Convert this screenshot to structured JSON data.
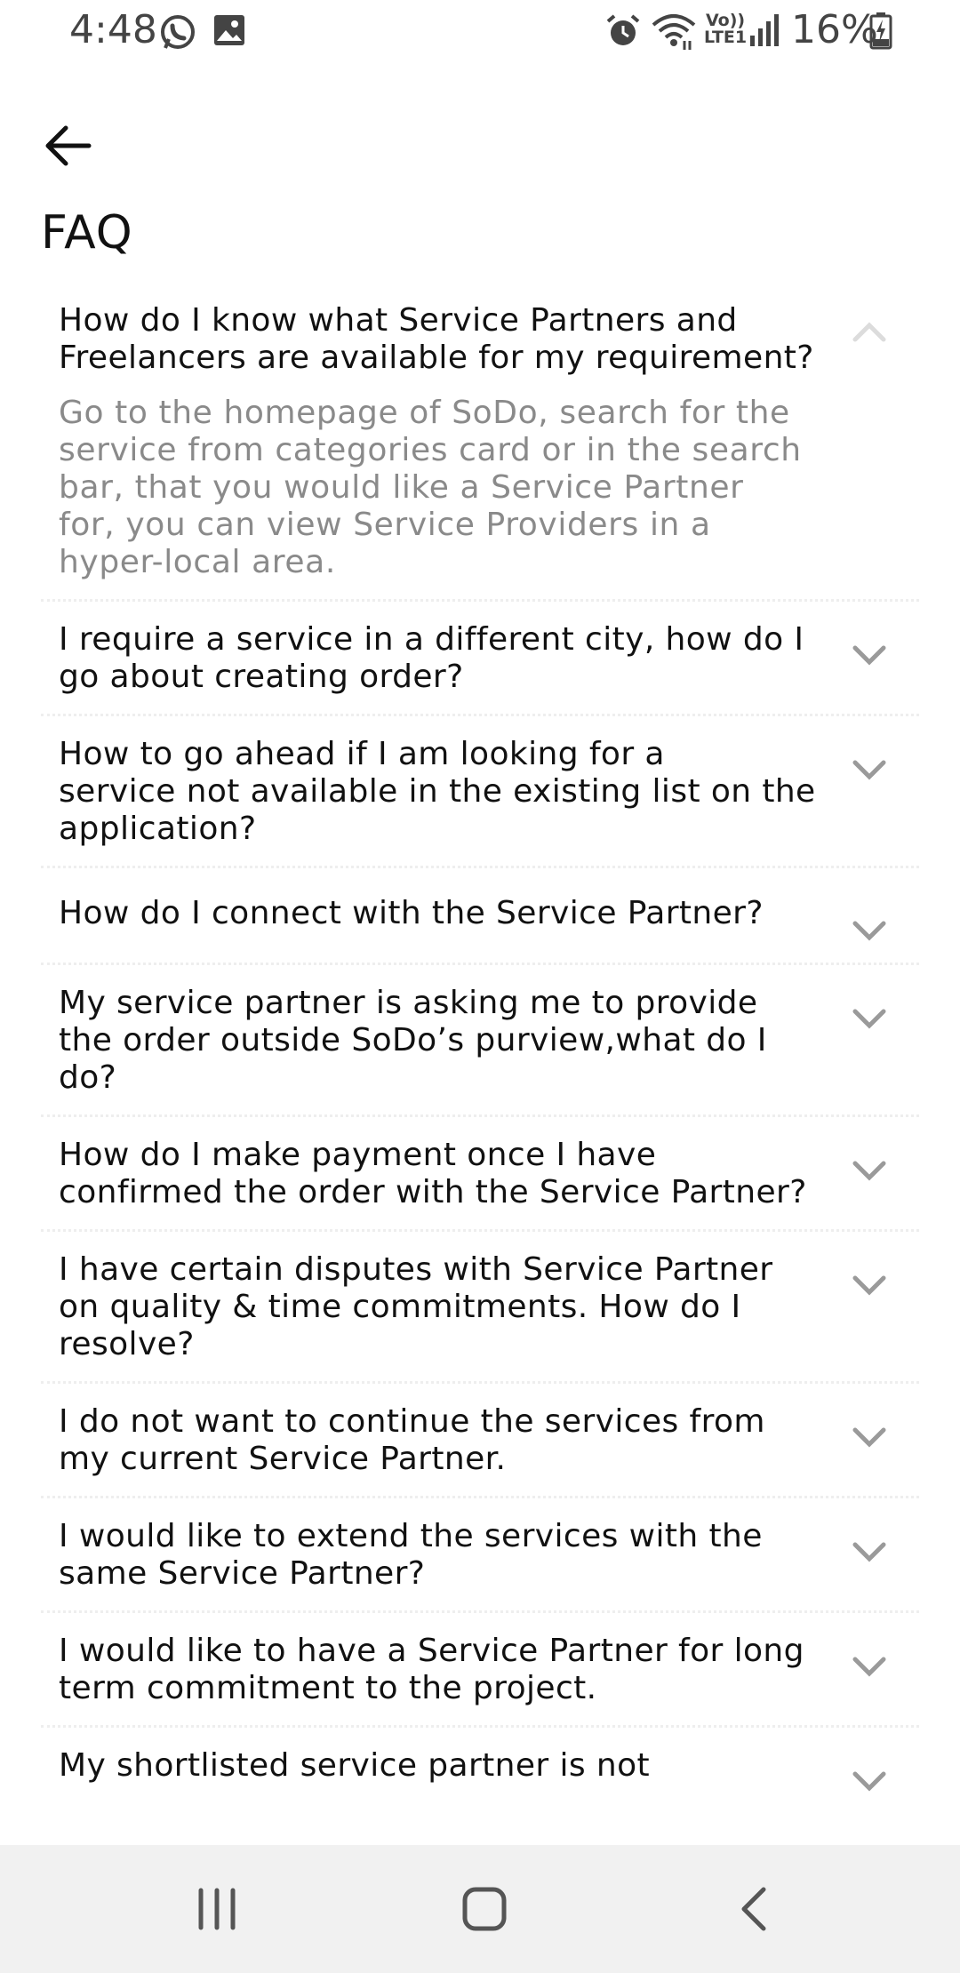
{
  "status_bar": {
    "time": "4:48",
    "left_icons": [
      "whatsapp-icon",
      "image-icon"
    ],
    "right_icons": [
      "alarm-icon",
      "wifi-icon",
      "volte-lte-icon",
      "signal-icon",
      "battery-charging-icon"
    ],
    "lte_label_top": "Vo))",
    "lte_label_bottom": "LTE1",
    "battery": "16%"
  },
  "header": {
    "back_icon": "arrow-left-icon",
    "title": "FAQ"
  },
  "faq": {
    "items": [
      {
        "question": "How do I know what Service Partners and\nFreelancers are available for my requirement?",
        "answer": "Go to the homepage of SoDo, search for the\nservice from categories card or in the search\nbar, that you would like a Service Partner\nfor, you can view Service Providers in a\nhyper-local area.",
        "expanded": true
      },
      {
        "question": "I require a service in a different city, how do I\ngo about creating order?",
        "expanded": false
      },
      {
        "question": "How to go ahead if I am looking for a\nservice not available in the existing list on the\napplication?",
        "expanded": false
      },
      {
        "question": "How do I connect with the Service Partner?",
        "expanded": false
      },
      {
        "question": "My service partner is asking me to provide\nthe order outside SoDo’s purview,what do I\ndo?",
        "expanded": false
      },
      {
        "question": "How do I make payment once I have\nconfirmed the order with the Service Partner?",
        "expanded": false
      },
      {
        "question": "I have certain disputes with Service Partner\non quality & time commitments. How do I\nresolve?",
        "expanded": false
      },
      {
        "question": "I do not want to continue the services from\nmy current Service Partner.",
        "expanded": false
      },
      {
        "question": "I would like to extend the services with the\nsame Service Partner?",
        "expanded": false
      },
      {
        "question": "I would like to have a Service Partner for long\nterm commitment to the project.",
        "expanded": false
      },
      {
        "question": "My shortlisted service partner is not",
        "expanded": false
      }
    ]
  },
  "nav_bar": {
    "icons": [
      "recent-apps-icon",
      "home-icon",
      "back-icon"
    ]
  }
}
